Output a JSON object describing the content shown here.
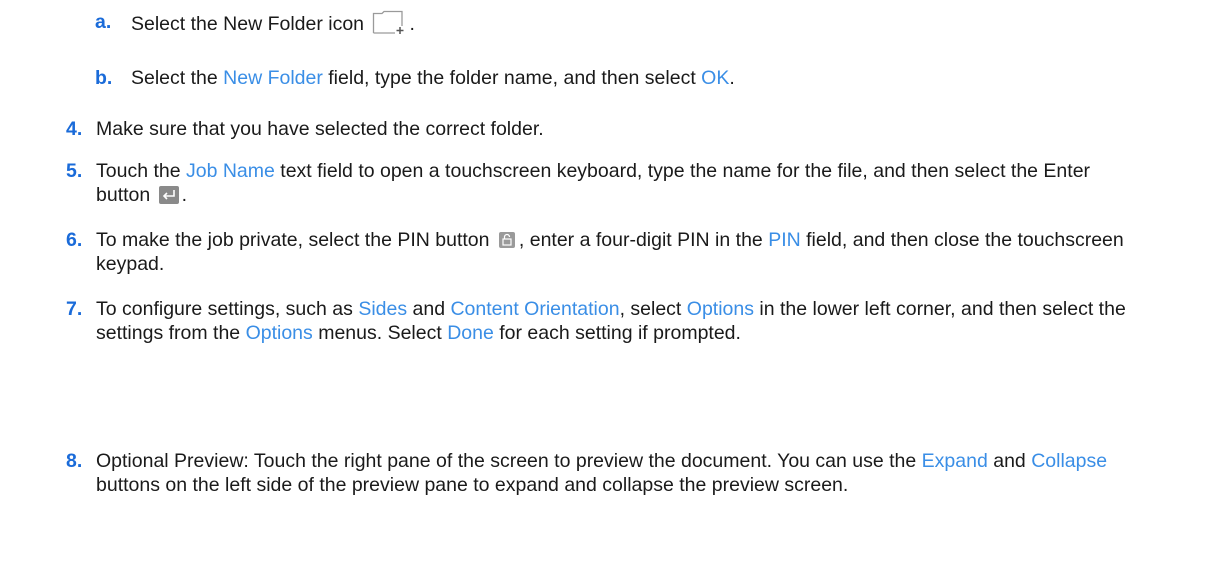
{
  "steps": {
    "a": {
      "num": "a.",
      "t1": "Select the New Folder icon",
      "t2": "."
    },
    "b": {
      "num": "b.",
      "t1": "Select the ",
      "ui1": "New Folder",
      "t2": " field, type the folder name, and then select ",
      "ui2": "OK",
      "t3": "."
    },
    "s4": {
      "num": "4.",
      "t1": "Make sure that you have selected the correct folder."
    },
    "s5": {
      "num": "5.",
      "t1": "Touch the ",
      "ui1": "Job Name",
      "t2": " text field to open a touchscreen keyboard, type the name for the file, and then select the Enter button",
      "t3": "."
    },
    "s6": {
      "num": "6.",
      "t1": "To make the job private, select the PIN button",
      "t2": ", enter a four-digit PIN in the ",
      "ui1": "PIN",
      "t3": " field, and then close the touchscreen keypad."
    },
    "s7": {
      "num": "7.",
      "t1": "To configure settings, such as ",
      "ui1": "Sides",
      "t2": " and ",
      "ui2": "Content Orientation",
      "t3": ", select ",
      "ui3": "Options",
      "t4": " in the lower left corner, and then select the settings from the ",
      "ui4": "Options",
      "t5": " menus. Select ",
      "ui5": "Done",
      "t6": " for each setting if prompted."
    },
    "s8": {
      "num": "8.",
      "t1": "Optional Preview: Touch the right pane of the screen to preview the document. You can use the ",
      "ui1": "Expand",
      "t2": " and ",
      "ui2": "Collapse",
      "t3": " buttons on the left side of the preview pane to expand and collapse the preview screen."
    }
  },
  "icons": {
    "new_folder": "new-folder-icon",
    "enter": "enter-icon",
    "pin": "pin-icon"
  },
  "colors": {
    "step_number": "#1a6bd9",
    "ui_term": "#3a8ee6",
    "body_text": "#1a1a1a"
  }
}
